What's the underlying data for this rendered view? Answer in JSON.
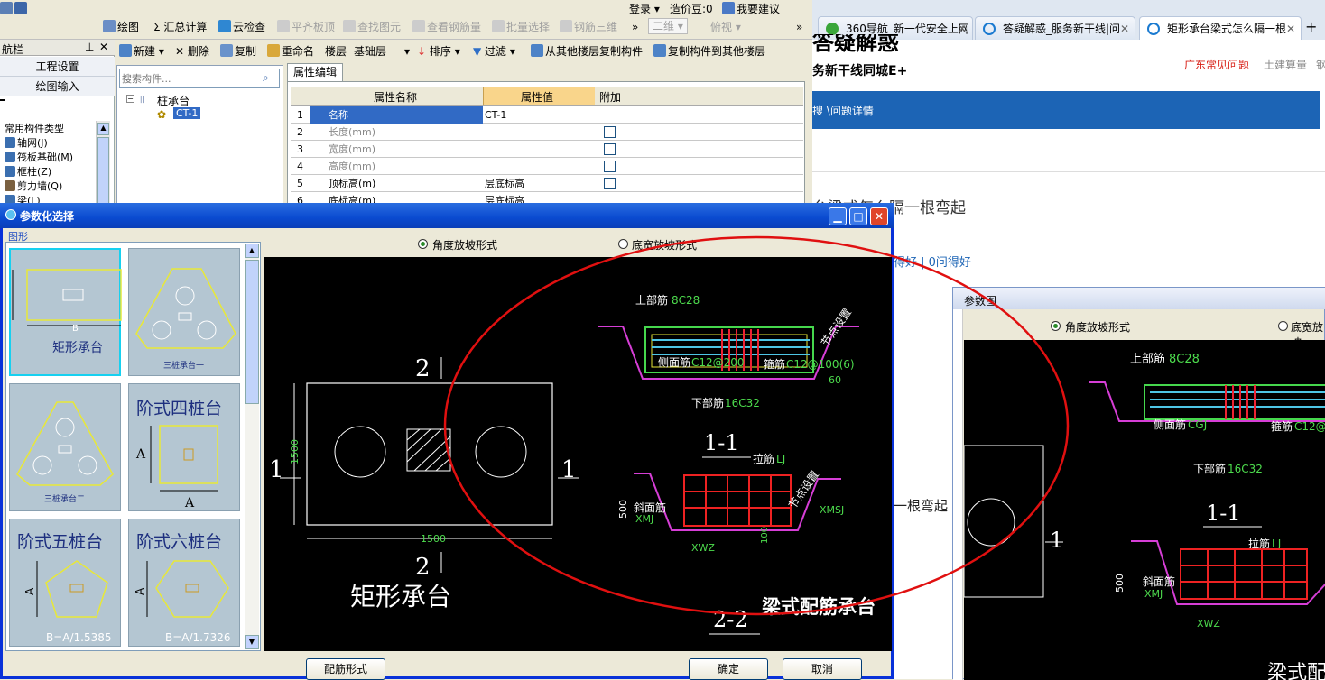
{
  "top_toolbar": {
    "login": "登录",
    "cost": "造价豆:0",
    "suggest": "我要建议",
    "draw": "绘图",
    "sum": "汇总计算",
    "cloud_check": "云检查",
    "flat_slab": "平齐板顶",
    "find_element": "查找图元",
    "view_rebar": "查看钢筋量",
    "batch_select": "批量选择",
    "rebar_3d": "钢筋三维",
    "view_2d": "二维",
    "view_top": "俯视"
  },
  "left_nav": {
    "title": "航栏",
    "pin": "ᵩ",
    "close": "✕",
    "project_settings": "工程设置",
    "draw_input": "绘图输入",
    "common_types": "常用构件类型",
    "items": [
      "轴网(J)",
      "筏板基础(M)",
      "框柱(Z)",
      "剪力墙(Q)",
      "梁(L)"
    ]
  },
  "component_toolbar": {
    "new": "新建",
    "delete": "删除",
    "copy": "复制",
    "rename": "重命名",
    "floor_label": "楼层",
    "floor_value": "基础层",
    "sort": "排序",
    "filter": "过滤",
    "copy_from_other": "从其他楼层复制构件",
    "copy_to_other": "复制构件到其他楼层"
  },
  "search": {
    "placeholder": "搜索构件..."
  },
  "tree": {
    "root": "桩承台",
    "child": "CT-1"
  },
  "property_panel": {
    "tab": "属性编辑",
    "headers": [
      "属性名称",
      "属性值",
      "附加"
    ],
    "rows": [
      {
        "no": "1",
        "name": "名称",
        "value": "CT-1"
      },
      {
        "no": "2",
        "name": "长度(mm)",
        "value": ""
      },
      {
        "no": "3",
        "name": "宽度(mm)",
        "value": ""
      },
      {
        "no": "4",
        "name": "高度(mm)",
        "value": ""
      },
      {
        "no": "5",
        "name": "顶标高(m)",
        "value": "层底标高"
      },
      {
        "no": "6",
        "name": "底标高(m)",
        "value": "层底标高"
      }
    ]
  },
  "browser": {
    "tabs": [
      "360导航_新一代安全上网",
      "答疑解惑_服务新干线|问",
      "矩形承台梁式怎么隔一根"
    ],
    "new_tab": "+",
    "header_partial": "务新干线同城E+",
    "header_logo_partial": "答疑解惑",
    "link1": "广东常见问题",
    "link2": "土建算量",
    "link3": "钢",
    "breadcrumb": "搜 \\问题详情",
    "question_title": "台梁式怎么隔一根弯起",
    "stats": "得好 | 0问得好",
    "side_text": "一根弯起"
  },
  "dialog": {
    "title": "参数化选择",
    "group_label": "图形",
    "radio_angle": "角度放坡形式",
    "radio_width": "底宽放坡形式",
    "thumbs": [
      {
        "label": "矩形承台",
        "selected": true
      },
      {
        "label": "三桩承台一"
      },
      {
        "label": "三桩承台二"
      },
      {
        "label": "阶式四桩台"
      },
      {
        "label": "阶式五桩台",
        "formula": "B=A/1.5385"
      },
      {
        "label": "阶式六桩台",
        "formula": "B=A/1.7326"
      }
    ],
    "btn_rebar_form": "配筋形式",
    "btn_ok": "确定",
    "btn_cancel": "取消"
  },
  "drawing": {
    "plan_title": "矩形承台",
    "dim_1500_v": "1500",
    "dim_1500_h": "1500",
    "sec_1": "1",
    "sec_2": "2",
    "upper_rebar_label": "上部筋",
    "upper_rebar_value": "8C28",
    "side_rebar_label": "侧面筋",
    "side_rebar_value": "C12@200",
    "stirrup_label": "箍筋",
    "stirrup_value": "C12@100(6)",
    "lower_rebar_label": "下部筋",
    "lower_rebar_value": "16C32",
    "node_setting": "节点设置",
    "angle": "60",
    "section_11": "1-1",
    "section_22": "2-2",
    "tie_label": "拉筋",
    "tie_value": "LJ",
    "slope_label": "斜面筋",
    "xmj": "XMJ",
    "xmsj": "XMSJ",
    "xwz": "XWZ",
    "h500": "500",
    "h100": "100",
    "beam_caption": "梁式配筋承台",
    "thumb_b": "B",
    "thumb_a": "A"
  },
  "param_window": {
    "title": "参数图",
    "radio_angle": "角度放坡形式",
    "radio_width": "底宽放坡",
    "upper_label": "上部筋",
    "upper_value": "8C28",
    "side_label": "侧面筋",
    "side_value": "CGJ",
    "stirrup_label": "箍筋",
    "stirrup_value": "C12@",
    "lower_label": "下部筋",
    "lower_value": "16C32",
    "section_11": "1-1",
    "tie_label": "拉筋",
    "tie_value": "LJ",
    "slope_label": "斜面筋",
    "xmj": "XMJ",
    "xwz": "XWZ",
    "h500": "500",
    "caption_partial": "梁式配",
    "sec_1": "1"
  }
}
